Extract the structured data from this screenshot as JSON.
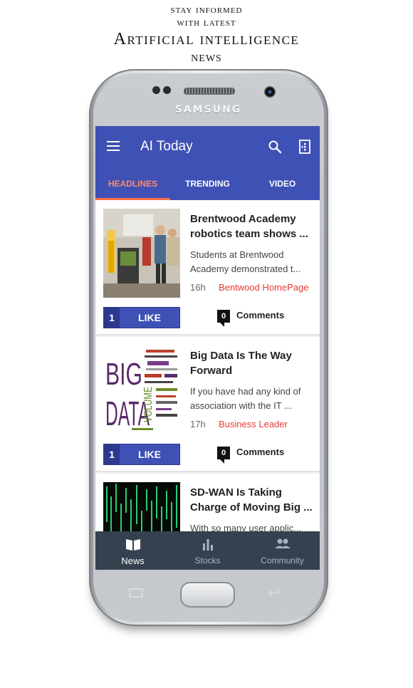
{
  "promo": {
    "line1": "stay informed",
    "line2": "with latest",
    "line3": "Artificial intelligence",
    "line4": "news"
  },
  "device": {
    "brand": "SAMSUNG"
  },
  "app": {
    "title": "AI Today",
    "tabs": [
      {
        "label": "HEADLINES",
        "active": true
      },
      {
        "label": "TRENDING",
        "active": false
      },
      {
        "label": "VIDEO",
        "active": false
      }
    ]
  },
  "articles": [
    {
      "title": "Brentwood Academy robotics team shows ...",
      "summary": "Students at Brentwood Academy demonstrated t...",
      "age": "16h",
      "source": "Bentwood HomePage",
      "likes": "1",
      "like_label": "LIKE",
      "comments": "0",
      "comments_label": "Comments",
      "image": "robotics-team-photo"
    },
    {
      "title": "Big Data Is The Way Forward",
      "summary": "If you have had any kind of association with the IT ...",
      "age": "17h",
      "source": "Business Leader",
      "likes": "1",
      "like_label": "LIKE",
      "comments": "0",
      "comments_label": "Comments",
      "image": "big-data-word-cloud",
      "image_text": [
        "BIG",
        "DATA",
        "VOLUME"
      ]
    },
    {
      "title": "SD-WAN Is Taking Charge of Moving Big ...",
      "summary": "With so many user applic...",
      "image": "matrix-code-image"
    }
  ],
  "bottom_nav": [
    {
      "label": "News",
      "icon": "book-icon",
      "active": true
    },
    {
      "label": "Stocks",
      "icon": "bar-chart-icon",
      "active": false
    },
    {
      "label": "Community",
      "icon": "people-icon",
      "active": false
    }
  ],
  "colors": {
    "primary": "#3f51b5",
    "accent": "#ff7043",
    "source_red": "#e53935",
    "bottom_nav": "#35414f"
  }
}
